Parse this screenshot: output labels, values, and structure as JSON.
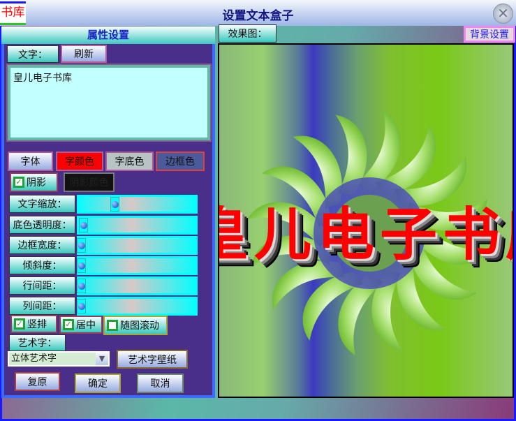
{
  "window": {
    "logo_text": "书库",
    "title": "设置文本盒子",
    "close_icon": "close-icon"
  },
  "props": {
    "header": "属性设置",
    "text_label": "文字：",
    "refresh": "刷新",
    "text_value": "皇儿电子书库",
    "font": "字体",
    "font_color": "字颜色",
    "bg_color": "字底色",
    "border_color": "边框色",
    "shadow": "阴影",
    "shadow_checked": true,
    "shadow_color": "阴影颜色",
    "sliders": [
      {
        "label": "文字缩放：",
        "value": 0.3
      },
      {
        "label": "底色透明度：",
        "value": 0.02
      },
      {
        "label": "边框宽度：",
        "value": 0
      },
      {
        "label": "倾斜度：",
        "value": 0
      },
      {
        "label": "行间距：",
        "value": 0
      },
      {
        "label": "列间距：",
        "value": 0
      }
    ],
    "vertical": "竖排",
    "vertical_checked": true,
    "center": "居中",
    "center_checked": true,
    "scroll": "随图滚动",
    "scroll_checked": false,
    "art_label": "艺术字：",
    "art_select": "立体艺术字",
    "art_wallpaper": "艺术字壁纸",
    "reset": "复原",
    "ok": "确定",
    "cancel": "取消"
  },
  "preview": {
    "tab": "效果图：",
    "bg_settings": "背景设置",
    "art_text": "皇儿电子书库"
  },
  "colors": {
    "font_color": "#ff0000",
    "bg_color": "#b8c4c4",
    "border_color": "#4a5a9a",
    "shadow_color": "#111111"
  }
}
